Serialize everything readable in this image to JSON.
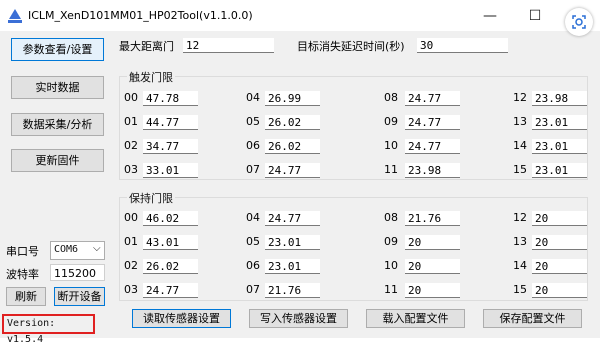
{
  "window": {
    "title": "ICLM_XenD101MM01_HP02Tool(v1.1.0.0)",
    "minimize": "—",
    "maximize": "☐"
  },
  "nav": {
    "params": "参数查看/设置",
    "realtime": "实时数据",
    "collect": "数据采集/分析",
    "firmware": "更新固件"
  },
  "top": {
    "max_dist_label": "最大距离门",
    "max_dist_value": "12",
    "delay_label": "目标消失延迟时间(秒)",
    "delay_value": "30"
  },
  "trigger": {
    "title": "触发门限",
    "items": [
      {
        "idx": "00",
        "val": "47.78"
      },
      {
        "idx": "04",
        "val": "26.99"
      },
      {
        "idx": "08",
        "val": "24.77"
      },
      {
        "idx": "12",
        "val": "23.98"
      },
      {
        "idx": "01",
        "val": "44.77"
      },
      {
        "idx": "05",
        "val": "26.02"
      },
      {
        "idx": "09",
        "val": "24.77"
      },
      {
        "idx": "13",
        "val": "23.01"
      },
      {
        "idx": "02",
        "val": "34.77"
      },
      {
        "idx": "06",
        "val": "26.02"
      },
      {
        "idx": "10",
        "val": "24.77"
      },
      {
        "idx": "14",
        "val": "23.01"
      },
      {
        "idx": "03",
        "val": "33.01"
      },
      {
        "idx": "07",
        "val": "24.77"
      },
      {
        "idx": "11",
        "val": "23.98"
      },
      {
        "idx": "15",
        "val": "23.01"
      }
    ]
  },
  "hold": {
    "title": "保持门限",
    "items": [
      {
        "idx": "00",
        "val": "46.02"
      },
      {
        "idx": "04",
        "val": "24.77"
      },
      {
        "idx": "08",
        "val": "21.76"
      },
      {
        "idx": "12",
        "val": "20"
      },
      {
        "idx": "01",
        "val": "43.01"
      },
      {
        "idx": "05",
        "val": "23.01"
      },
      {
        "idx": "09",
        "val": "20"
      },
      {
        "idx": "13",
        "val": "20"
      },
      {
        "idx": "02",
        "val": "26.02"
      },
      {
        "idx": "06",
        "val": "23.01"
      },
      {
        "idx": "10",
        "val": "20"
      },
      {
        "idx": "14",
        "val": "20"
      },
      {
        "idx": "03",
        "val": "24.77"
      },
      {
        "idx": "07",
        "val": "21.76"
      },
      {
        "idx": "11",
        "val": "20"
      },
      {
        "idx": "15",
        "val": "20"
      }
    ]
  },
  "serial": {
    "port_label": "串口号",
    "port_value": "COM6",
    "baud_label": "波特率",
    "baud_value": "115200",
    "refresh": "刷新",
    "disconnect": "断开设备"
  },
  "actions": {
    "read": "读取传感器设置",
    "write": "写入传感器设置",
    "load": "载入配置文件",
    "save": "保存配置文件"
  },
  "version": "Version: v1.5.4"
}
